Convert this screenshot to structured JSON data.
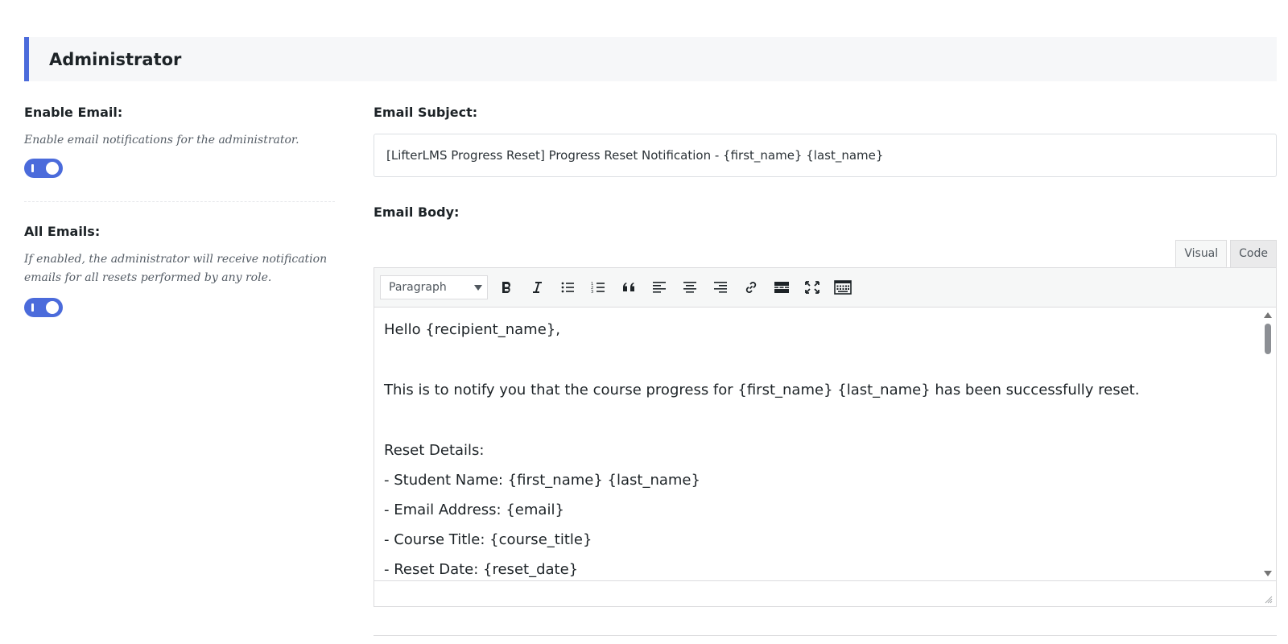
{
  "section": {
    "title": "Administrator"
  },
  "enable_email": {
    "label": "Enable Email:",
    "description": "Enable email notifications for the administrator.",
    "enabled": true
  },
  "all_emails": {
    "label": "All Emails:",
    "description_line1": "If enabled, the administrator will receive notification",
    "description_line2": "emails for all resets performed by any role.",
    "enabled": true
  },
  "email_subject": {
    "label": "Email Subject:",
    "value": "[LifterLMS Progress Reset] Progress Reset Notification - {first_name} {last_name}"
  },
  "email_body": {
    "label": "Email Body:",
    "tabs": [
      "Visual",
      "Code"
    ],
    "active_tab": "Visual",
    "format_select": "Paragraph",
    "toolbar_icons": [
      "bold-icon",
      "italic-icon",
      "bulleted-list-icon",
      "numbered-list-icon",
      "blockquote-icon",
      "align-left-icon",
      "align-center-icon",
      "align-right-icon",
      "link-icon",
      "read-more-icon",
      "fullscreen-icon",
      "toolbar-toggle-icon"
    ],
    "content": [
      "Hello {recipient_name},",
      "",
      "This is to notify you that the course progress for {first_name} {last_name} has been successfully reset.",
      "",
      "Reset Details:",
      "- Student Name: {first_name} {last_name}",
      "- Email Address: {email}",
      "- Course Title: {course_title}",
      "- Reset Date: {reset_date}"
    ]
  },
  "colors": {
    "accent": "#4b6bdb",
    "header_bg": "#f6f7f9",
    "text": "#1d2327",
    "muted": "#555d66"
  }
}
